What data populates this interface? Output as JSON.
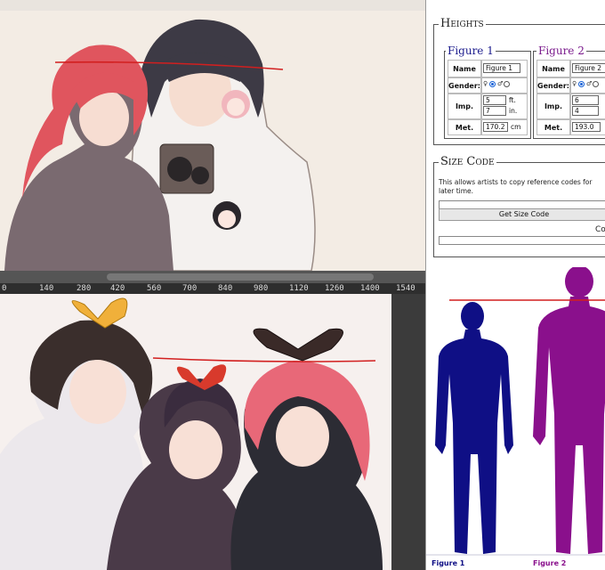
{
  "top_ruler_labels": [
    "140",
    "280",
    "420",
    "560",
    "700",
    "840",
    "980",
    "1120",
    "1260",
    "1400",
    "1540"
  ],
  "form": {
    "heights_legend": "Heights",
    "figures": [
      {
        "legend": "Figure 1",
        "legend_color": "#1a1a8c",
        "name_label": "Name",
        "name_value": "Figure 1",
        "gender_label": "Gender:",
        "imp_label": "Imp.",
        "feet_value": "5",
        "feet_unit": "ft.",
        "inches_value": "7",
        "inches_unit": "in.",
        "met_label": "Met.",
        "met_value": "170.2",
        "met_unit": "cm"
      },
      {
        "legend": "Figure 2",
        "legend_color": "#7a1a8c",
        "name_label": "Name",
        "name_value": "Figure 2",
        "gender_label": "Gender:",
        "imp_label": "Imp.",
        "feet_value": "6",
        "inches_value": "4",
        "met_label": "Met.",
        "met_value": "193.0"
      }
    ],
    "size_code_legend": "Size Code",
    "size_code_description": "This allows artists to copy reference codes for later time.",
    "get_size_code_label": "Get Size Code",
    "co_text": "Co"
  },
  "silhouettes": {
    "figure1_caption": "Figure 1",
    "figure1_color": "#0f0f85",
    "figure2_caption": "Figure 2",
    "figure2_color": "#8a108c"
  }
}
